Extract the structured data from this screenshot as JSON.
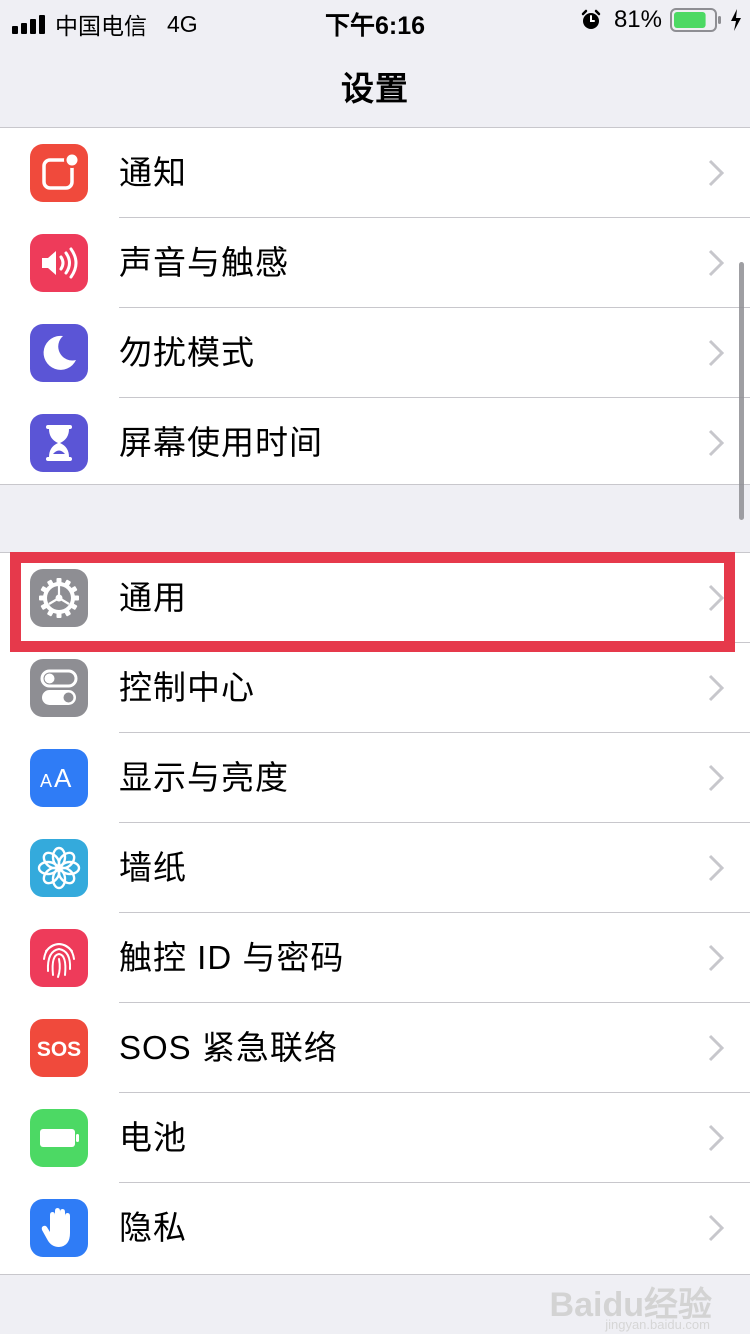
{
  "status_bar": {
    "carrier": "中国电信",
    "network": "4G",
    "time": "下午6:16",
    "battery_percent": "81%",
    "battery_level": 0.81,
    "icons": [
      "signal-icon",
      "alarm-icon",
      "battery-icon",
      "charging-icon"
    ]
  },
  "nav": {
    "title": "设置"
  },
  "groups": [
    {
      "items": [
        {
          "label": "通知",
          "icon": "notifications-icon",
          "color": "#f04a3c"
        },
        {
          "label": "声音与触感",
          "icon": "sounds-icon",
          "color": "#ee3b5a"
        },
        {
          "label": "勿扰模式",
          "icon": "do-not-disturb-icon",
          "color": "#5b55d6"
        },
        {
          "label": "屏幕使用时间",
          "icon": "screen-time-icon",
          "color": "#5b55d6"
        }
      ]
    },
    {
      "items": [
        {
          "label": "通用",
          "icon": "general-gear-icon",
          "color": "#8e8e93"
        },
        {
          "label": "控制中心",
          "icon": "control-center-icon",
          "color": "#8e8e93"
        },
        {
          "label": "显示与亮度",
          "icon": "display-brightness-icon",
          "color": "#2f7cf6"
        },
        {
          "label": "墙纸",
          "icon": "wallpaper-icon",
          "color": "#34aadc"
        },
        {
          "label": "触控 ID 与密码",
          "icon": "touch-id-icon",
          "color": "#ee3b5a"
        },
        {
          "label": "SOS 紧急联络",
          "icon": "sos-icon",
          "color": "#f04a3c"
        },
        {
          "label": "电池",
          "icon": "battery-settings-icon",
          "color": "#4cd964"
        },
        {
          "label": "隐私",
          "icon": "privacy-hand-icon",
          "color": "#2f7cf6"
        }
      ]
    }
  ],
  "highlight": {
    "target": "通用",
    "color": "#e6394b"
  },
  "watermark": {
    "text": "Baidu经验",
    "sub": "jingyan.baidu.com"
  }
}
